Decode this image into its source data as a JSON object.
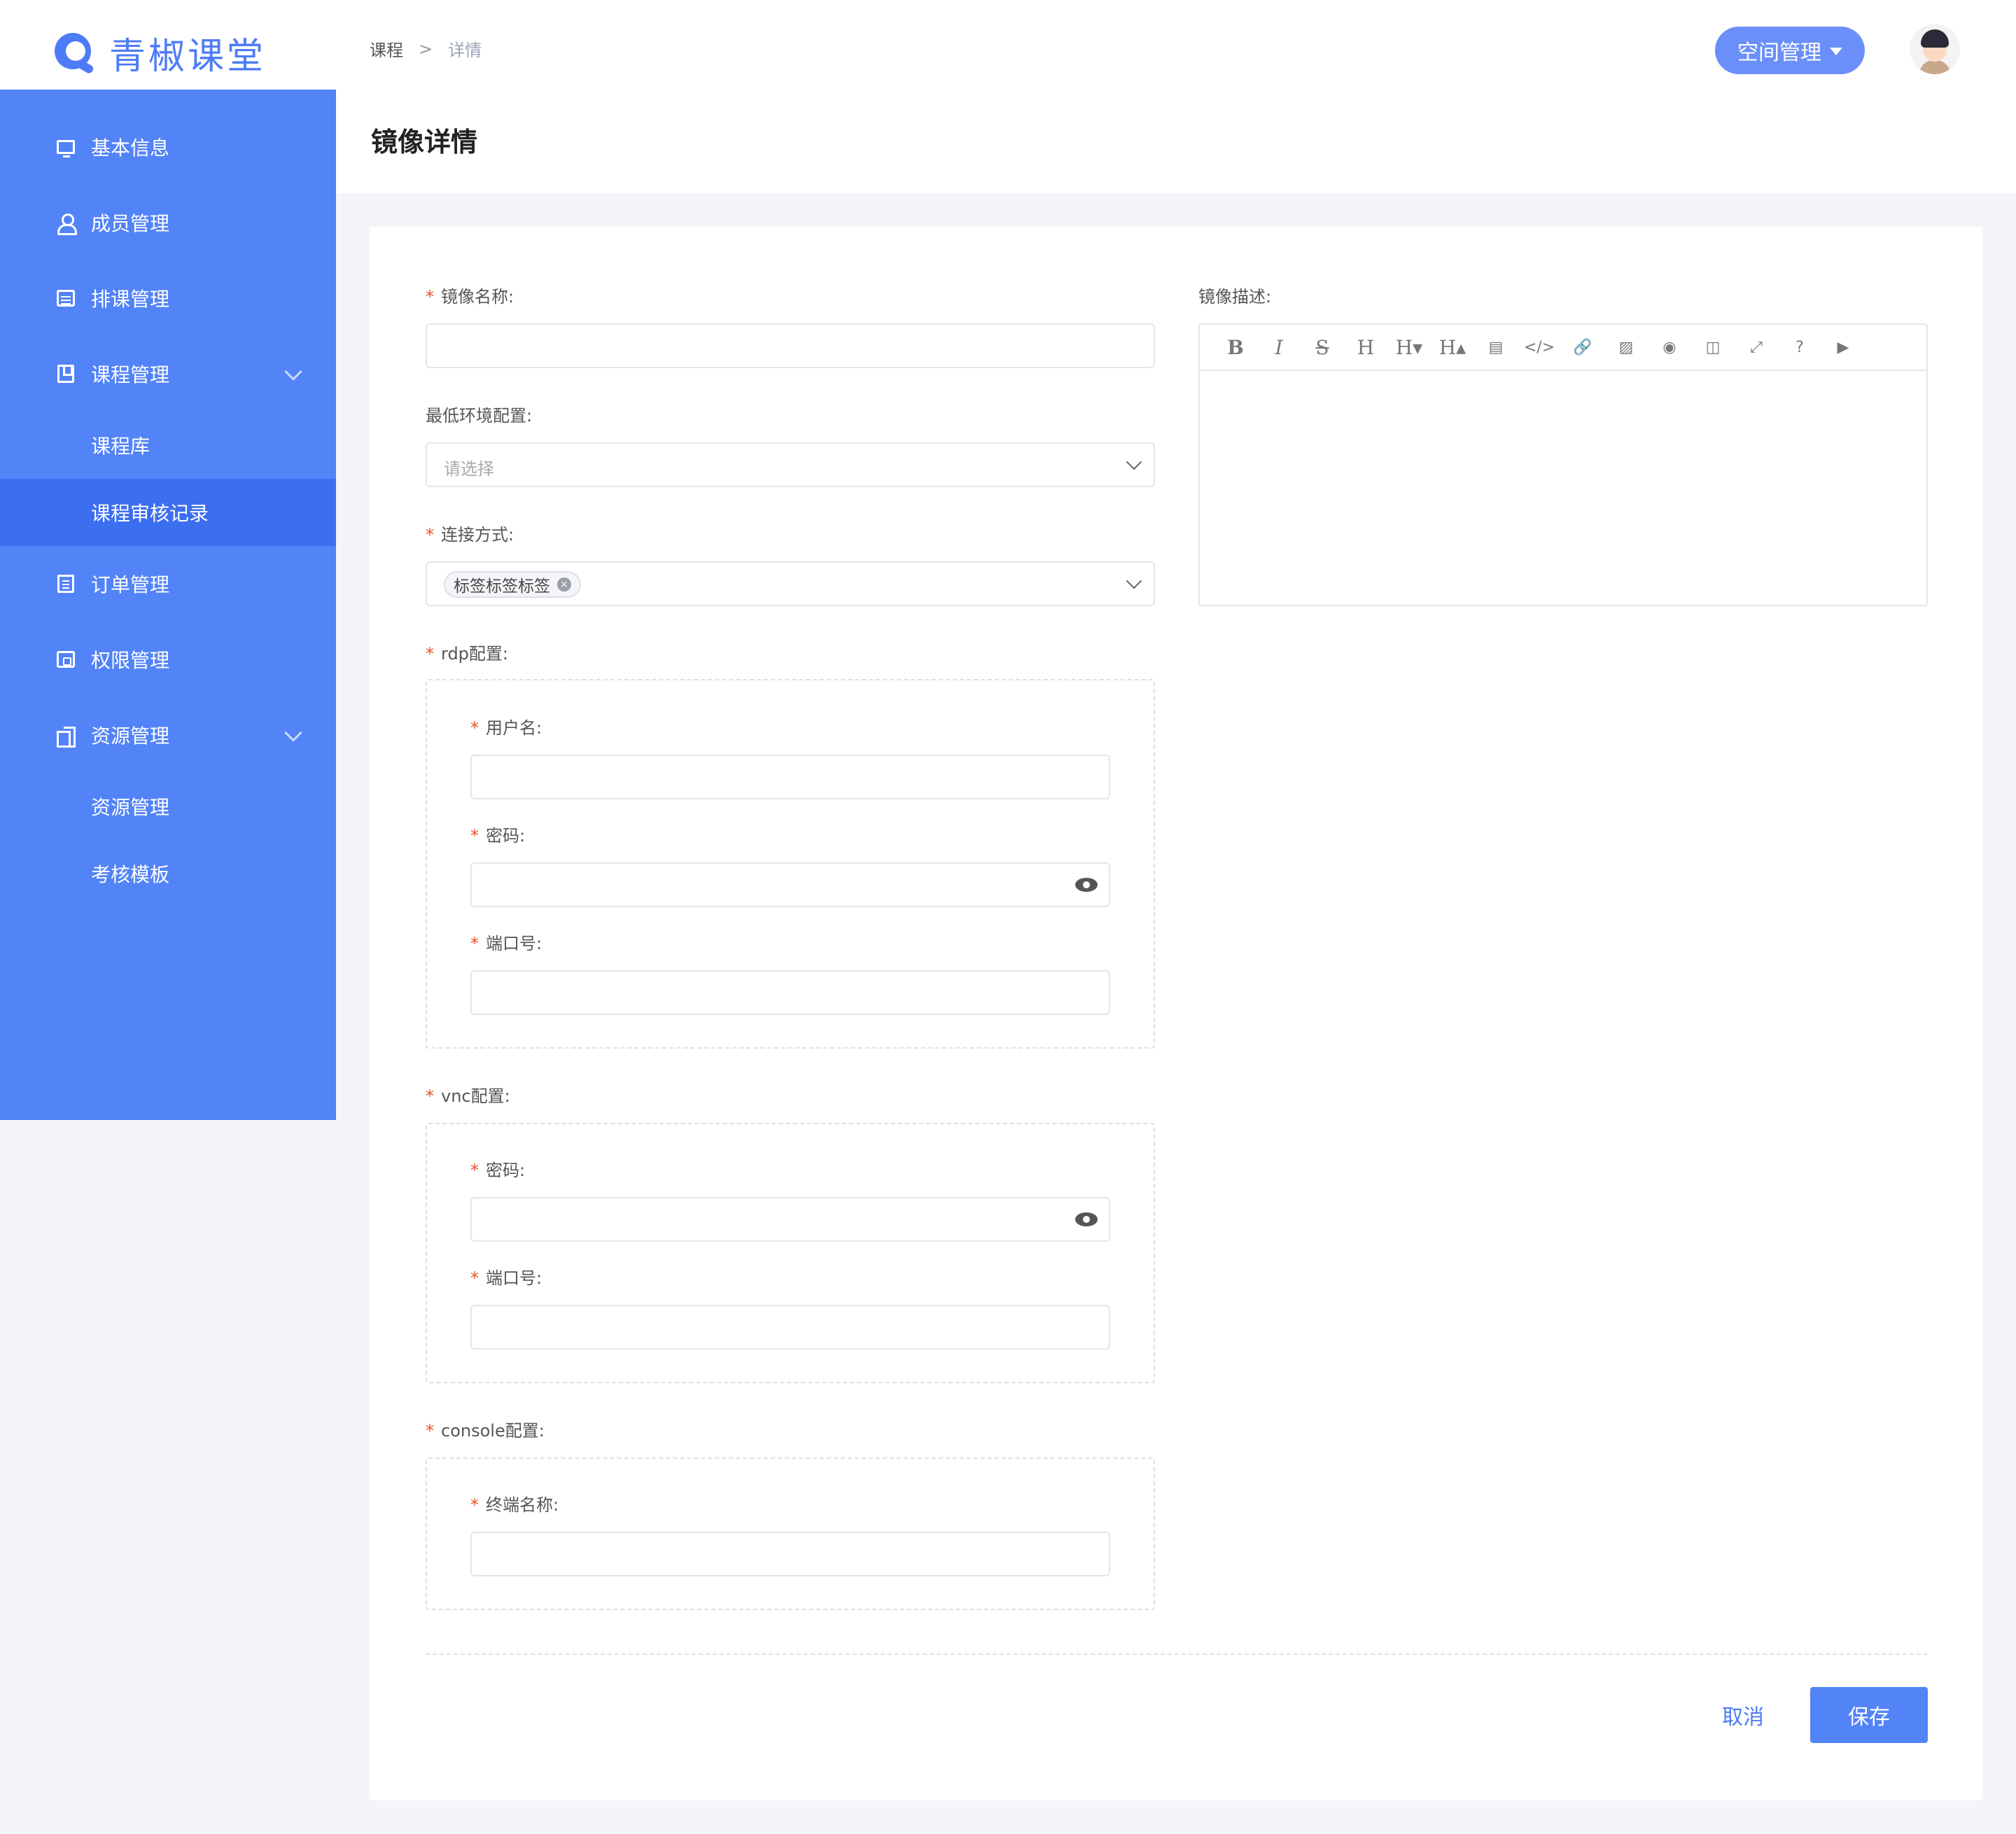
{
  "header": {
    "logo_text": "青椒课堂",
    "breadcrumb": [
      "课程",
      ">",
      "详情"
    ],
    "space_button": "空间管理"
  },
  "sidebar": {
    "items": [
      {
        "label": "基本信息",
        "icon": "monitor-icon"
      },
      {
        "label": "成员管理",
        "icon": "user-icon"
      },
      {
        "label": "排课管理",
        "icon": "calendar-icon"
      },
      {
        "label": "课程管理",
        "icon": "book-icon",
        "expanded": true
      },
      {
        "label": "课程库",
        "sub": true
      },
      {
        "label": "课程审核记录",
        "sub": true,
        "active": true
      },
      {
        "label": "订单管理",
        "icon": "list-icon"
      },
      {
        "label": "权限管理",
        "icon": "key-icon"
      },
      {
        "label": "资源管理",
        "icon": "resource-icon",
        "expanded": true
      },
      {
        "label": "资源管理",
        "sub": true
      },
      {
        "label": "考核模板",
        "sub": true
      }
    ]
  },
  "page": {
    "title": "镜像详情"
  },
  "form": {
    "name_label": "镜像名称:",
    "name_value": "",
    "env_label": "最低环境配置:",
    "env_placeholder": "请选择",
    "connect_label": "连接方式:",
    "connect_tag": "标签标签标签",
    "rdp_label": "rdp配置:",
    "rdp_user_label": "用户名:",
    "rdp_password_label": "密码:",
    "rdp_port_label": "端口号:",
    "vnc_label": "vnc配置:",
    "vnc_password_label": "密码:",
    "vnc_port_label": "端口号:",
    "console_label": "console配置:",
    "console_terminal_label": "终端名称:",
    "desc_label": "镜像描述:"
  },
  "editor_toolbar": [
    "B",
    "I",
    "S",
    "H",
    "H▾",
    "H▴",
    "▤",
    "</>",
    "🔗",
    "▨",
    "◉",
    "◫",
    "⤢",
    "?",
    "▶"
  ],
  "actions": {
    "cancel": "取消",
    "save": "保存"
  },
  "colors": {
    "primary": "#5283f7",
    "sidebar_active": "#3c6ef0",
    "required": "#e5522b"
  }
}
